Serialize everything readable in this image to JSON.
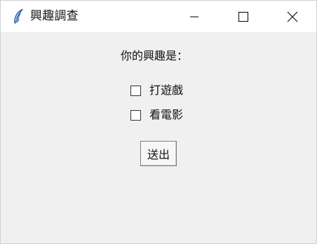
{
  "window": {
    "title": "興趣調查",
    "icon": "feather-icon"
  },
  "controls": {
    "minimize": "minimize-icon",
    "maximize": "maximize-icon",
    "close": "close-icon"
  },
  "form": {
    "prompt": "你的興趣是：",
    "options": [
      {
        "label": "打遊戲",
        "checked": false
      },
      {
        "label": "看電影",
        "checked": false
      }
    ],
    "submit_label": "送出"
  }
}
